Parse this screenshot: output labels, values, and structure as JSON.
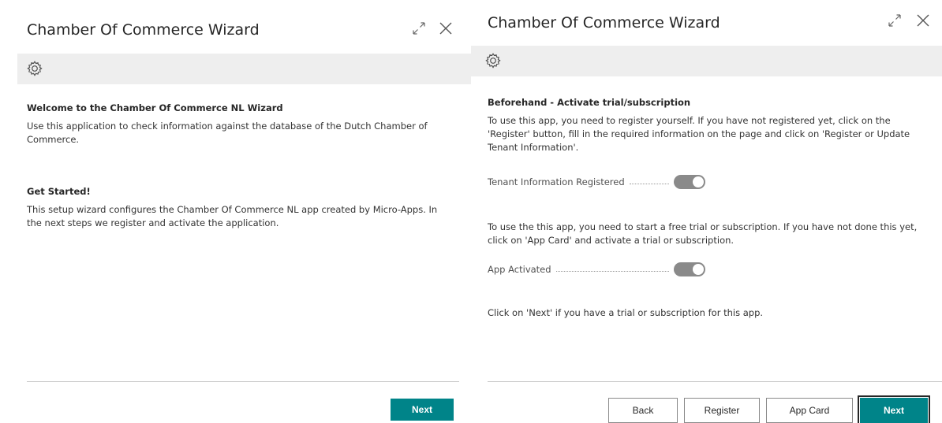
{
  "left_panel": {
    "title": "Chamber Of Commerce Wizard",
    "welcome_heading": "Welcome to the Chamber Of Commerce NL Wizard",
    "welcome_text": "Use this application to check information against the database of the Dutch Chamber of Commerce.",
    "started_heading": "Get Started!",
    "started_text": "This setup wizard configures the Chamber Of Commerce NL app created by Micro-Apps. In the next steps we register and activate the application.",
    "next_label": "Next"
  },
  "right_panel": {
    "title": "Chamber Of Commerce Wizard",
    "step_heading": "Beforehand - Activate trial/subscription",
    "register_text": "To use this app, you need to register yourself. If you have not registered yet, click on the 'Register' button, fill in the required information on the page and click on 'Register or Update Tenant Information'.",
    "tenant_label": "Tenant Information Registered",
    "tenant_registered": true,
    "trial_text": "To use the this app, you need to start a free trial or subscription. If you have not done this yet, click on 'App Card' and activate a trial or subscription.",
    "activated_label": "App Activated",
    "app_activated": true,
    "next_hint": "Click on 'Next' if you have a trial or subscription for this app.",
    "buttons": {
      "back": "Back",
      "register": "Register",
      "app_card": "App Card",
      "next": "Next"
    }
  },
  "colors": {
    "accent": "#008489",
    "band": "#eeeeee",
    "toggle": "#8a8a8a"
  },
  "icons": [
    "expand-icon",
    "close-icon",
    "gear-icon"
  ]
}
